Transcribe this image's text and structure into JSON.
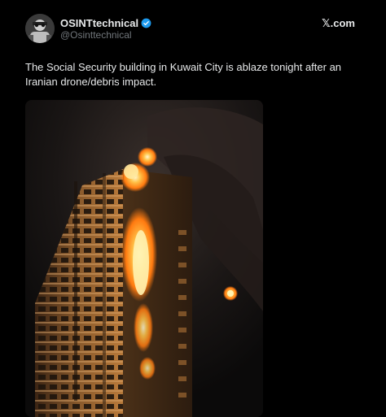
{
  "tweet": {
    "display_name": "OSINTtechnical",
    "handle": "@Osinttechnical",
    "brand": "𝕏.com",
    "text": "The Social Security building in Kuwait City is ablaze tonight after an Iranian drone/debris impact."
  },
  "colors": {
    "background": "#000000",
    "text_primary": "#e7e9ea",
    "text_secondary": "#71767b",
    "verified_badge": "#1d9bf0"
  },
  "icons": {
    "verified": "verified-badge-icon",
    "avatar": "avatar-image"
  }
}
